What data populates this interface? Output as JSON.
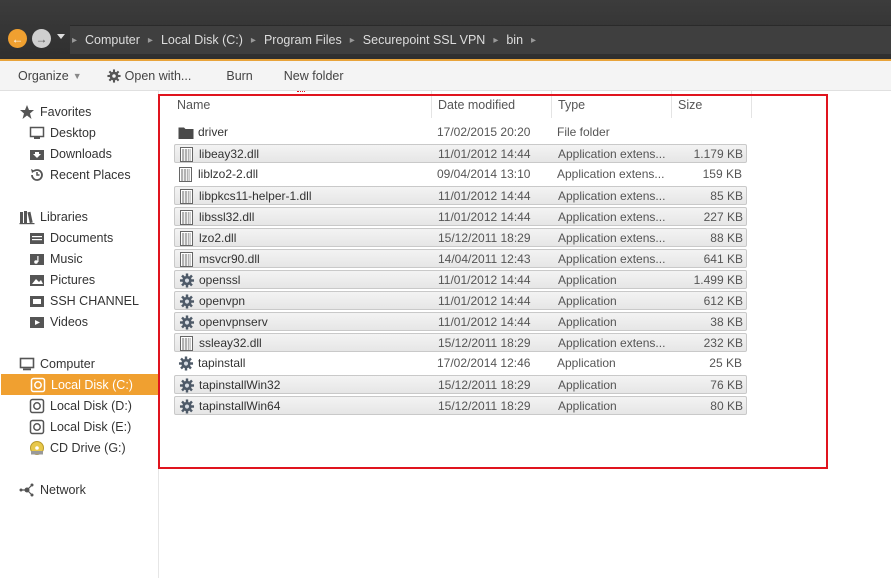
{
  "address": {
    "crumbs": [
      "Computer",
      "Local Disk (C:)",
      "Program Files",
      "Securepoint SSL VPN",
      "bin"
    ]
  },
  "toolbar": {
    "organize": "Organize",
    "open_with": "Open with...",
    "burn": "Burn",
    "new_folder": "New folder"
  },
  "sidebar": {
    "favorites": "Favorites",
    "desktop": "Desktop",
    "downloads": "Downloads",
    "recent": "Recent Places",
    "libraries": "Libraries",
    "documents": "Documents",
    "music": "Music",
    "pictures": "Pictures",
    "ssh": "SSH CHANNEL",
    "videos": "Videos",
    "computer": "Computer",
    "disk_c": "Local Disk (C:)",
    "disk_d": "Local Disk (D:)",
    "disk_e": "Local Disk (E:)",
    "cd_g": "CD Drive (G:)",
    "network": "Network"
  },
  "columns": {
    "name": "Name",
    "date": "Date modified",
    "type": "Type",
    "size": "Size"
  },
  "files": [
    {
      "name": "driver",
      "date": "17/02/2015 20:20",
      "type": "File folder",
      "size": "",
      "icon": "folder-icon",
      "selected": false
    },
    {
      "name": "libeay32.dll",
      "date": "11/01/2012 14:44",
      "type": "Application extens...",
      "size": "1.179 KB",
      "icon": "dll-icon",
      "selected": true
    },
    {
      "name": "liblzo2-2.dll",
      "date": "09/04/2014 13:10",
      "type": "Application extens...",
      "size": "159 KB",
      "icon": "dll-icon",
      "selected": false
    },
    {
      "name": "libpkcs11-helper-1.dll",
      "date": "11/01/2012 14:44",
      "type": "Application extens...",
      "size": "85 KB",
      "icon": "dll-icon",
      "selected": true
    },
    {
      "name": "libssl32.dll",
      "date": "11/01/2012 14:44",
      "type": "Application extens...",
      "size": "227 KB",
      "icon": "dll-icon",
      "selected": true
    },
    {
      "name": "lzo2.dll",
      "date": "15/12/2011 18:29",
      "type": "Application extens...",
      "size": "88 KB",
      "icon": "dll-icon",
      "selected": true
    },
    {
      "name": "msvcr90.dll",
      "date": "14/04/2011 12:43",
      "type": "Application extens...",
      "size": "641 KB",
      "icon": "dll-icon",
      "selected": true
    },
    {
      "name": "openssl",
      "date": "11/01/2012 14:44",
      "type": "Application",
      "size": "1.499 KB",
      "icon": "exe-gear-icon",
      "selected": true
    },
    {
      "name": "openvpn",
      "date": "11/01/2012 14:44",
      "type": "Application",
      "size": "612 KB",
      "icon": "exe-gear-icon",
      "selected": true
    },
    {
      "name": "openvpnserv",
      "date": "11/01/2012 14:44",
      "type": "Application",
      "size": "38 KB",
      "icon": "exe-gear-icon",
      "selected": true
    },
    {
      "name": "ssleay32.dll",
      "date": "15/12/2011 18:29",
      "type": "Application extens...",
      "size": "232 KB",
      "icon": "dll-icon",
      "selected": true
    },
    {
      "name": "tapinstall",
      "date": "17/02/2014 12:46",
      "type": "Application",
      "size": "25 KB",
      "icon": "exe-gear-icon",
      "selected": false
    },
    {
      "name": "tapinstallWin32",
      "date": "15/12/2011 18:29",
      "type": "Application",
      "size": "76 KB",
      "icon": "exe-gear-icon",
      "selected": true
    },
    {
      "name": "tapinstallWin64",
      "date": "15/12/2011 18:29",
      "type": "Application",
      "size": "80 KB",
      "icon": "exe-gear-icon",
      "selected": true
    }
  ],
  "colors": {
    "accent": "#f0a030",
    "annotation": "#e0141e"
  }
}
